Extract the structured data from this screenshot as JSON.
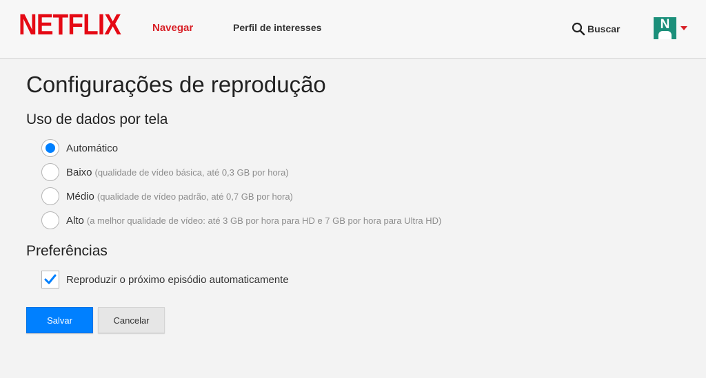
{
  "header": {
    "logo": "NETFLIX",
    "nav": [
      {
        "label": "Navegar"
      },
      {
        "label": "Perfil de interesses"
      }
    ],
    "search_label": "Buscar",
    "avatar_letter": "N"
  },
  "page": {
    "title": "Configurações de reprodução",
    "data_usage": {
      "title": "Uso de dados por tela",
      "selected": "Automático",
      "options": [
        {
          "label": "Automático",
          "desc": ""
        },
        {
          "label": "Baixo",
          "desc": "(qualidade de vídeo básica, até 0,3 GB por hora)"
        },
        {
          "label": "Médio",
          "desc": "(qualidade de vídeo padrão, até 0,7 GB por hora)"
        },
        {
          "label": "Alto",
          "desc": "(a melhor qualidade de vídeo: até 3 GB por hora para HD e 7 GB por hora para Ultra HD)"
        }
      ]
    },
    "preferences": {
      "title": "Preferências",
      "autoplay_label": "Reproduzir o próximo episódio automaticamente",
      "autoplay_checked": true
    },
    "buttons": {
      "save": "Salvar",
      "cancel": "Cancelar"
    }
  },
  "colors": {
    "brand": "#e50914",
    "accent": "#0080ff",
    "nav_active": "#d81f26"
  }
}
